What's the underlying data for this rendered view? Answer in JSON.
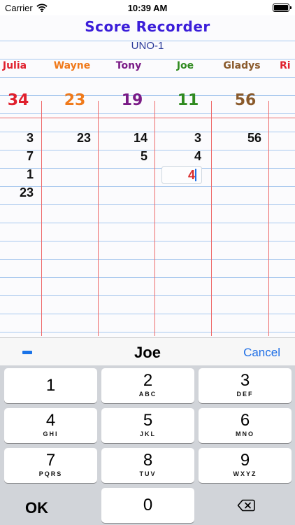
{
  "status": {
    "carrier": "Carrier",
    "time": "10:39 AM"
  },
  "app": {
    "title": "Score Recorder",
    "subtitle": "UNO-1"
  },
  "players": [
    {
      "name": "Julia",
      "total": "34",
      "color": "#e0202d",
      "scores": [
        "3",
        "7",
        "1",
        "23"
      ]
    },
    {
      "name": "Wayne",
      "total": "23",
      "color": "#f07a1b",
      "scores": [
        "23"
      ]
    },
    {
      "name": "Tony",
      "total": "19",
      "color": "#7a1b86",
      "scores": [
        "14",
        "5"
      ]
    },
    {
      "name": "Joe",
      "total": "11",
      "color": "#2f8a1f",
      "scores": [
        "3",
        "4"
      ]
    },
    {
      "name": "Gladys",
      "total": "56",
      "color": "#8a5a2b",
      "scores": [
        "56"
      ]
    },
    {
      "name": "Ri",
      "color": "#e0202d"
    }
  ],
  "editing": {
    "player": "Joe",
    "value": "4"
  },
  "keypad": {
    "cancel": "Cancel",
    "ok": "OK",
    "keys": [
      {
        "digit": "1",
        "letters": ""
      },
      {
        "digit": "2",
        "letters": "ABC"
      },
      {
        "digit": "3",
        "letters": "DEF"
      },
      {
        "digit": "4",
        "letters": "GHI"
      },
      {
        "digit": "5",
        "letters": "JKL"
      },
      {
        "digit": "6",
        "letters": "MNO"
      },
      {
        "digit": "7",
        "letters": "PQRS"
      },
      {
        "digit": "8",
        "letters": "TUV"
      },
      {
        "digit": "9",
        "letters": "WXYZ"
      },
      {
        "digit": "0",
        "letters": ""
      }
    ]
  }
}
